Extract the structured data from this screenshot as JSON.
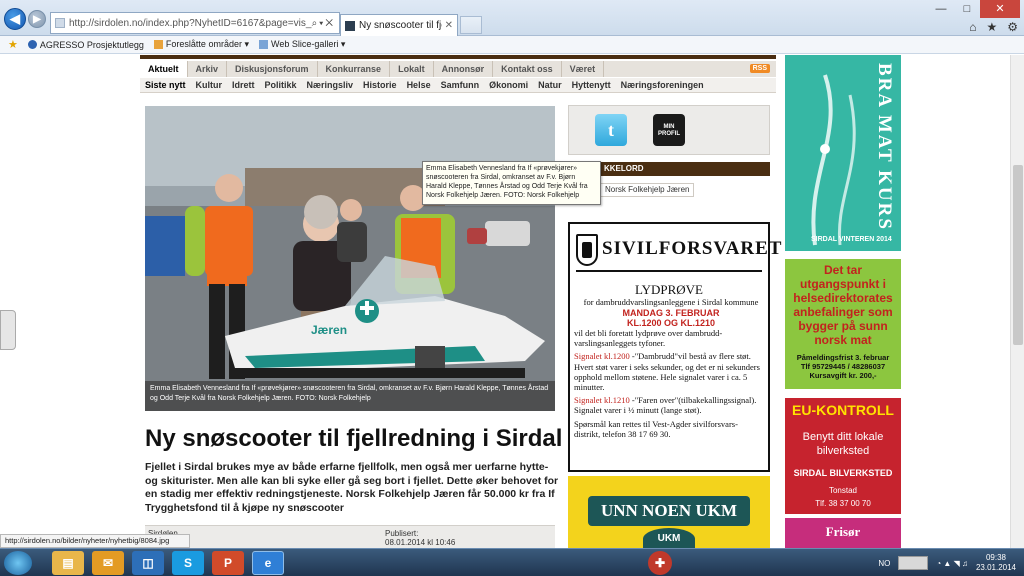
{
  "browser": {
    "url": "http://sirdolen.no/index.php?NyhetID=6167&page=vis_nyhet",
    "tab_title": "Ny snøscooter til fjellrednin...",
    "favorites": [
      "AGRESSO Prosjektutlegg",
      "Foreslåtte områder ▾",
      "Web Slice-galleri ▾"
    ],
    "status_url": "http://sirdolen.no/bilder/nyheter/nyhetbig/8084.jpg"
  },
  "nav": {
    "main": [
      "Aktuelt",
      "Arkiv",
      "Diskusjonsforum",
      "Konkurranse",
      "Lokalt",
      "Annonsør",
      "Kontakt oss",
      "Været"
    ],
    "rss": "RSS",
    "sub": [
      "Siste nytt",
      "Kultur",
      "Idrett",
      "Politikk",
      "Næringsliv",
      "Historie",
      "Helse",
      "Samfunn",
      "Økonomi",
      "Natur",
      "Hyttenytt",
      "Næringsforeningen"
    ]
  },
  "article": {
    "caption": "Emma Elisabeth Vennesland fra If «prøvekjører» snøscooteren fra Sirdal, omkranset av F.v. Bjørn Harald Kleppe, Tønnes Årstad og Odd Terje Kvål fra Norsk Folkehjelp Jæren. FOTO: Norsk Folkehjelp",
    "tooltip": "Emma Elisabeth Vennesland fra If «prøvekjører» snøscooteren fra Sirdal, omkranset av  F.v. Bjørn Harald Kleppe, Tønnes Årstad og Odd Terje Kvål fra Norsk Folkehjelp Jæren. FOTO: Norsk Folkehjelp",
    "headline": "Ny snøscooter til fjellredning i Sirdal",
    "lead": "Fjellet i Sirdal brukes mye av både erfarne fjellfolk, men også mer uerfarne hytte- og skiturister. Men alle kan bli syke eller gå seg bort i fjellet. Dette øker behovet for en stadig mer effektiv redningstjeneste. Norsk Folkehjelp Jæren får 50.000 kr fra If Trygghetsfond til å kjøpe ny snøscooter",
    "meta_left": "Sirdølen",
    "meta_published_label": "Publisert:",
    "meta_published": "08.01.2014 kl 10:46"
  },
  "sidebar": {
    "twitter": "t",
    "profile": "MIN PROFIL",
    "keywords_head": "KKELORD",
    "keyword_tag": "Norsk Folkehjelp Jæren",
    "scooter_label": "Jæren"
  },
  "sivilforsvaret": {
    "title": "SIVILFORSVARET",
    "sub": "LYDPRØVE",
    "purpose": "for dambruddvarslingsanleggene i Sirdal kommune",
    "date1": "MANDAG 3. FEBRUAR",
    "date2": "KL.1200 OG KL.1210",
    "intro": "vil det bli foretatt lydprøve over dambrudd-varslingsanleggets tyfoner.",
    "sig1_label": "Signalet kl.1200",
    "sig1_text": " -\"Dambrudd\"vil bestå av flere støt. Hvert støt varer i seks sekunder, og det er ni sekunders opphold mellom støtene. Hele signalet varer i ca. 5 minutter.",
    "sig2_label": "Signalet kl.1210",
    "sig2_text": " -\"Faren over\"(tilbakekallingssignal). Signalet varer i ½ minutt (lange støt).",
    "contact": "Spørsmål kan rettes til Vest-Agder sivilforsvars-distrikt, telefon 38 17 69 30."
  },
  "ukm": {
    "banner": "UNN NOEN UKM",
    "badge": "UKM"
  },
  "bramat": {
    "title": "BRA MAT KURS",
    "sub": "SIRDAL VINTEREN 2014",
    "text": "Det tar utgangspunkt i helsedirektorates anbefalinger som bygger på sunn norsk mat",
    "foot1": "Påmeldingsfrist 3. februar",
    "foot2": "Tlf 95729445 / 48286037",
    "foot3": "Kursavgift kr. 200,-"
  },
  "eu": {
    "title": "EU-KONTROLL",
    "text": "Benytt ditt lokale bilverksted",
    "shop": "SIRDAL BILVERKSTED",
    "town": "Tonstad",
    "phone": "Tlf. 38 37 00 70"
  },
  "frisor": {
    "title": "Frisør"
  },
  "taskbar": {
    "lang": "NO",
    "time": "09:38",
    "date": "23.01.2014"
  }
}
